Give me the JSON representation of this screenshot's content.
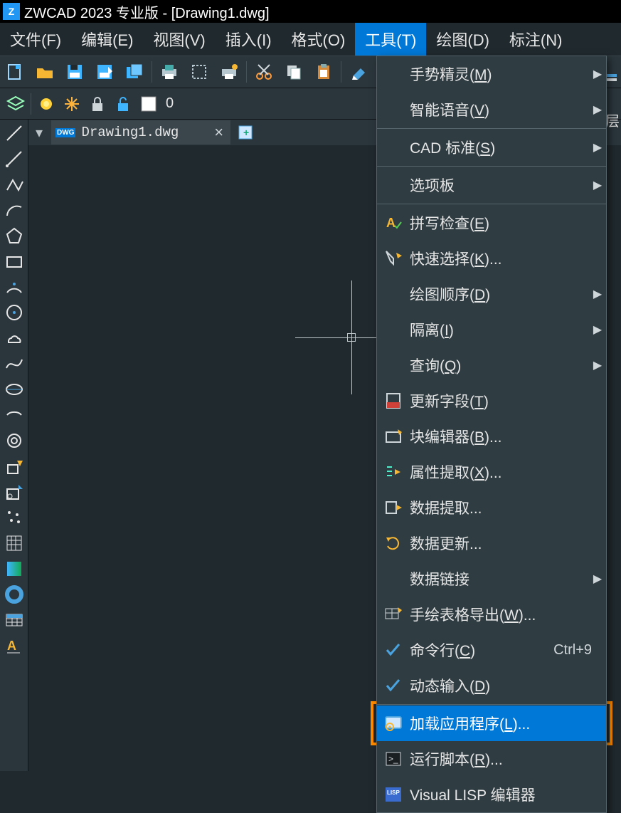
{
  "title": "ZWCAD 2023 专业版 - [Drawing1.dwg]",
  "menubar": [
    "文件(F)",
    "编辑(E)",
    "视图(V)",
    "插入(I)",
    "格式(O)",
    "工具(T)",
    "绘图(D)",
    "标注(N)"
  ],
  "menubar_active_index": 5,
  "layer_num": "0",
  "doc_tab": {
    "name": "Drawing1.dwg",
    "badge": "DWG"
  },
  "right_sliver": "层",
  "dropdown": {
    "highlighted_index": 18,
    "items": [
      {
        "label_pre": "手势精灵(",
        "u": "M",
        "label_post": ")",
        "arrow": true
      },
      {
        "label_pre": "智能语音(",
        "u": "V",
        "label_post": ")",
        "arrow": true
      },
      {
        "sep": true
      },
      {
        "label_pre": "CAD 标准(",
        "u": "S",
        "label_post": ")",
        "arrow": true
      },
      {
        "sep": true
      },
      {
        "label_pre": "选项板",
        "u": "",
        "label_post": "",
        "arrow": true
      },
      {
        "sep": true
      },
      {
        "icon": "spell",
        "label_pre": "拼写检查(",
        "u": "E",
        "label_post": ")"
      },
      {
        "icon": "qselect",
        "label_pre": "快速选择(",
        "u": "K",
        "label_post": ")..."
      },
      {
        "label_pre": "绘图顺序(",
        "u": "D",
        "label_post": ")",
        "arrow": true
      },
      {
        "label_pre": "隔离(",
        "u": "I",
        "label_post": ")",
        "arrow": true
      },
      {
        "label_pre": "查询(",
        "u": "Q",
        "label_post": ")",
        "arrow": true
      },
      {
        "icon": "field",
        "label_pre": "更新字段(",
        "u": "T",
        "label_post": ")"
      },
      {
        "icon": "bedit",
        "label_pre": "块编辑器(",
        "u": "B",
        "label_post": ")..."
      },
      {
        "icon": "attr",
        "label_pre": "属性提取(",
        "u": "X",
        "label_post": ")..."
      },
      {
        "icon": "dext",
        "label_pre": "数据提取...",
        "u": "",
        "label_post": ""
      },
      {
        "icon": "dupd",
        "label_pre": "数据更新...",
        "u": "",
        "label_post": ""
      },
      {
        "label_pre": "数据链接",
        "u": "",
        "label_post": "",
        "arrow": true
      },
      {
        "icon": "tblexp",
        "label_pre": "手绘表格导出(",
        "u": "W",
        "label_post": ")..."
      },
      {
        "icon": "check",
        "label_pre": "命令行(",
        "u": "C",
        "label_post": ")",
        "shortcut": "Ctrl+9"
      },
      {
        "icon": "check",
        "label_pre": "动态输入(",
        "u": "D",
        "label_post": ")"
      },
      {
        "sep": true
      },
      {
        "icon": "load",
        "label_pre": "加载应用程序(",
        "u": "L",
        "label_post": ")...",
        "highlighted": true
      },
      {
        "icon": "script",
        "label_pre": "运行脚本(",
        "u": "R",
        "label_post": ")..."
      },
      {
        "icon": "lisp",
        "label_pre": "Visual LISP 编辑器",
        "u": "",
        "label_post": ""
      }
    ]
  }
}
